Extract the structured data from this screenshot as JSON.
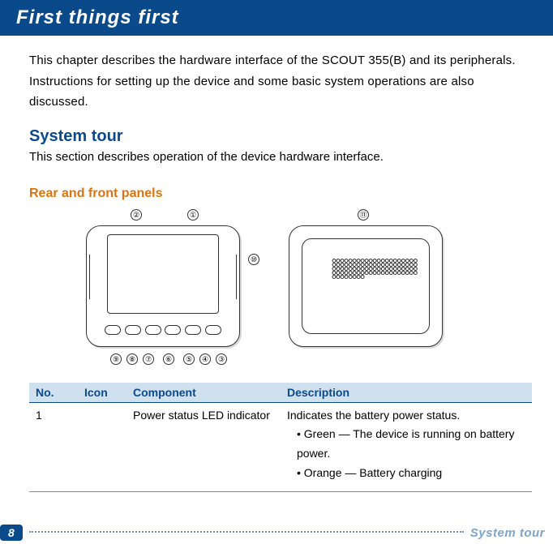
{
  "title": "First things first",
  "intro": "This chapter describes the hardware interface of the SCOUT 355(B) and its peripherals. Instructions for setting up the device and some basic system operations are also discussed.",
  "system_tour": {
    "heading": "System tour",
    "text": "This section describes operation of the device hardware interface."
  },
  "subheading": "Rear and front panels",
  "callout_labels": {
    "c1": "①",
    "c2": "②",
    "c3": "③",
    "c4": "④",
    "c5": "⑤",
    "c6": "⑥",
    "c7": "⑦",
    "c8": "⑧",
    "c9": "⑨",
    "c10": "⑩",
    "c11": "⑪"
  },
  "table": {
    "headers": {
      "no": "No.",
      "icon": "Icon",
      "component": "Component",
      "description": "Description"
    },
    "row1": {
      "no": "1",
      "icon": "",
      "component": "Power status LED indicator",
      "description": "Indicates the battery power status.",
      "bullets": {
        "a": "Green — The device is running on battery power.",
        "b": "Orange — Battery charging"
      }
    }
  },
  "page": "8",
  "footer_label": "System tour"
}
